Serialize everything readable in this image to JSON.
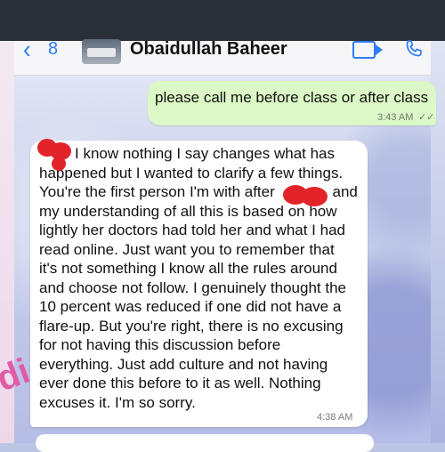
{
  "header": {
    "back_count": "8",
    "contact_name": "Obaidullah Baheer"
  },
  "messages": {
    "outgoing": {
      "text": "please call me before class or after class",
      "time": "3:43 AM"
    },
    "incoming": {
      "lines": [
        "I know nothing I say changes what has",
        "happened but I wanted to clarify a few things.",
        "You're the first person I'm with after",
        "and",
        "my understanding of all this is based on how",
        "lightly her doctors had told her and what I had",
        "read online. Just want you to remember that",
        "it's not something I know all the rules around",
        "and choose not follow. I genuinely thought the",
        "10 percent was reduced if one did not have a",
        "flare-up. But you're right, there is no excusing",
        "for not having this discussion before",
        "everything. Just add culture and not having",
        "ever done this before to it as well. Nothing",
        "excuses it. I'm so sorry."
      ],
      "time": "4:38 AM"
    }
  },
  "colors": {
    "accent": "#2f7df6",
    "outgoing_bubble": "#dcf8c6",
    "redaction": "#e2242a"
  },
  "icons": [
    "chevron-left-icon",
    "video-call-icon",
    "phone-call-icon",
    "read-receipt-icon"
  ]
}
